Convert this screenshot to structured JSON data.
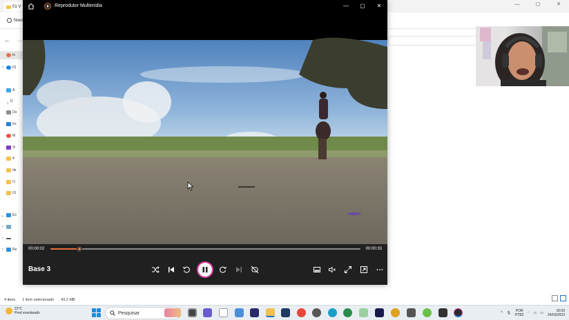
{
  "explorer": {
    "tab_label": "01 V",
    "new_label": "Novo",
    "nav_items": [
      "In",
      "01",
      "Á",
      "D",
      "Do",
      "Im",
      "M",
      "Vi",
      "4",
      "de",
      "O",
      "01",
      "Es",
      "",
      "",
      "Re"
    ],
    "status_items_count": "4 itens",
    "status_selected": "1 item selecionado",
    "status_size": "43,2 MB"
  },
  "player": {
    "app_title": "Reprodutor Multimídia",
    "current_time": "00:00:02",
    "duration": "00:00:33",
    "progress": 0.094,
    "media_title": "Base 3",
    "accent_color": "#e8703a",
    "icons": [
      "home-icon",
      "app-icon",
      "minimize-icon",
      "maximize-icon",
      "close-icon",
      "shuffle-icon",
      "previous-icon",
      "rewind-icon",
      "pause-icon",
      "forward-icon",
      "next-icon",
      "repeat-icon",
      "miniplayer-icon",
      "volume-icon",
      "fullscreen-icon",
      "cast-icon",
      "more-icon"
    ]
  },
  "taskbar": {
    "weather_temp": "31°C",
    "weather_desc": "Pred ensolarado",
    "search_placeholder": "Pesquisar",
    "lang_line1": "POR",
    "lang_line2": "PTB2",
    "clock_time": "16:03",
    "clock_date": "24/03/2023"
  }
}
